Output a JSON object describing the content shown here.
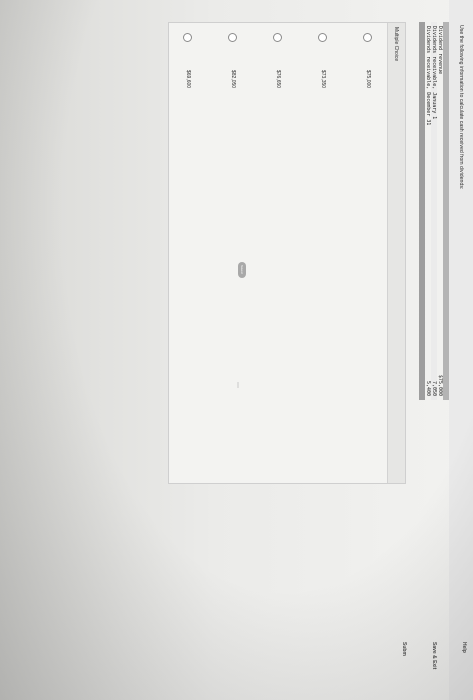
{
  "question": {
    "prompt": "Use the following information to calculate cash received from dividends:"
  },
  "data_table": {
    "rows": [
      {
        "label": "Dividend revenue",
        "amount": "$75,000"
      },
      {
        "label": "Dividends receivable, January 1",
        "amount": "7,050"
      },
      {
        "label": "Dividends receivable, December 31",
        "amount": "5,400"
      }
    ]
  },
  "multiple_choice": {
    "title": "Multiple Choice",
    "options": [
      {
        "label": "$75,000"
      },
      {
        "label": "$73,350"
      },
      {
        "label": "$76,650"
      },
      {
        "label": "$82,050"
      },
      {
        "label": "$69,600"
      }
    ]
  },
  "footer": {
    "saved_label": "Saved",
    "help_label": "Help",
    "save_exit_label": "Save & Exit",
    "submit_label": "Subm"
  }
}
